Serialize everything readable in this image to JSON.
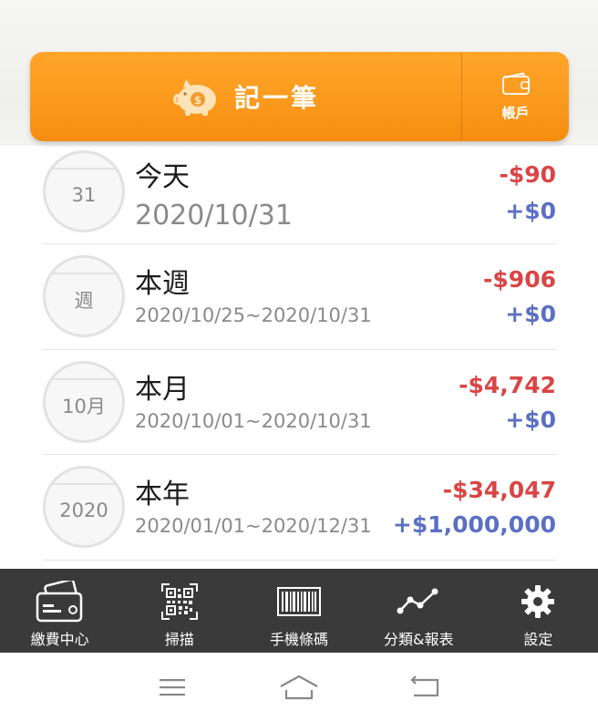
{
  "header": {
    "record_label": "記一筆",
    "account_label": "帳戶"
  },
  "periods": [
    {
      "circle": "31",
      "title": "今天",
      "range": "2020/10/31",
      "expense": "-$90",
      "income": "+$0"
    },
    {
      "circle": "週",
      "title": "本週",
      "range": "2020/10/25~2020/10/31",
      "expense": "-$906",
      "income": "+$0"
    },
    {
      "circle": "10月",
      "title": "本月",
      "range": "2020/10/01~2020/10/31",
      "expense": "-$4,742",
      "income": "+$0"
    },
    {
      "circle": "2020",
      "title": "本年",
      "range": "2020/01/01~2020/12/31",
      "expense": "-$34,047",
      "income": "+$1,000,000"
    }
  ],
  "nav": [
    {
      "label": "繳費中心",
      "icon": "bill-card-icon"
    },
    {
      "label": "掃描",
      "icon": "qr-code-icon"
    },
    {
      "label": "手機條碼",
      "icon": "barcode-icon"
    },
    {
      "label": "分類&報表",
      "icon": "trend-chart-icon"
    },
    {
      "label": "設定",
      "icon": "gear-icon"
    }
  ],
  "colors": {
    "accent": "#fb9a1d",
    "expense": "#d94545",
    "income": "#5b6fc4",
    "nav_bg": "#3a3a3a"
  }
}
